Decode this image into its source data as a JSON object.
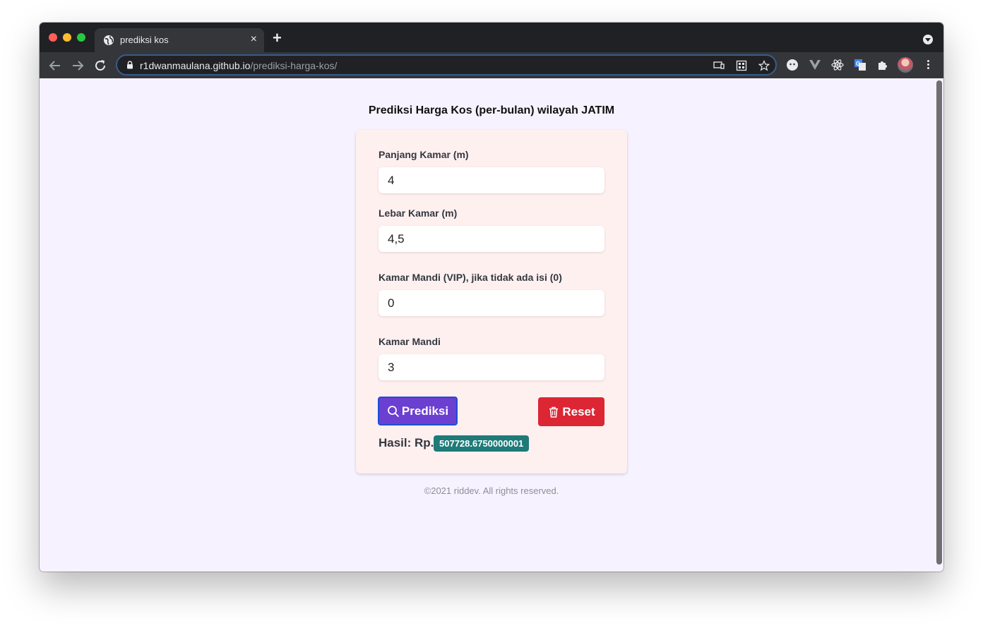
{
  "browser": {
    "tab_title": "prediksi kos",
    "tab_close": "×",
    "new_tab": "+",
    "url_host": "r1dwanmaulana.github.io",
    "url_path": "/prediksi-harga-kos/"
  },
  "page": {
    "title": "Prediksi Harga Kos (per-bulan) wilayah JATIM",
    "footer": "©2021 riddev. All rights reserved."
  },
  "form": {
    "fields": [
      {
        "label": "Panjang Kamar (m)",
        "value": "4"
      },
      {
        "label": "Lebar Kamar (m)",
        "value": "4,5"
      },
      {
        "label": "Kamar Mandi (VIP), jika tidak ada isi (0)",
        "value": "0"
      },
      {
        "label": "Kamar Mandi",
        "value": "3"
      }
    ],
    "predict_label": "Prediksi",
    "reset_label": "Reset",
    "result_label": "Hasil: Rp.",
    "result_value": "507728.6750000001"
  },
  "colors": {
    "predict_button": "#6b3fd0",
    "reset_button": "#dc2633",
    "result_badge": "#1f7a78",
    "card_background": "#fff0f0",
    "page_background": "#f7f2ff"
  },
  "icons": {
    "predict": "search-icon",
    "reset": "trash-icon"
  }
}
